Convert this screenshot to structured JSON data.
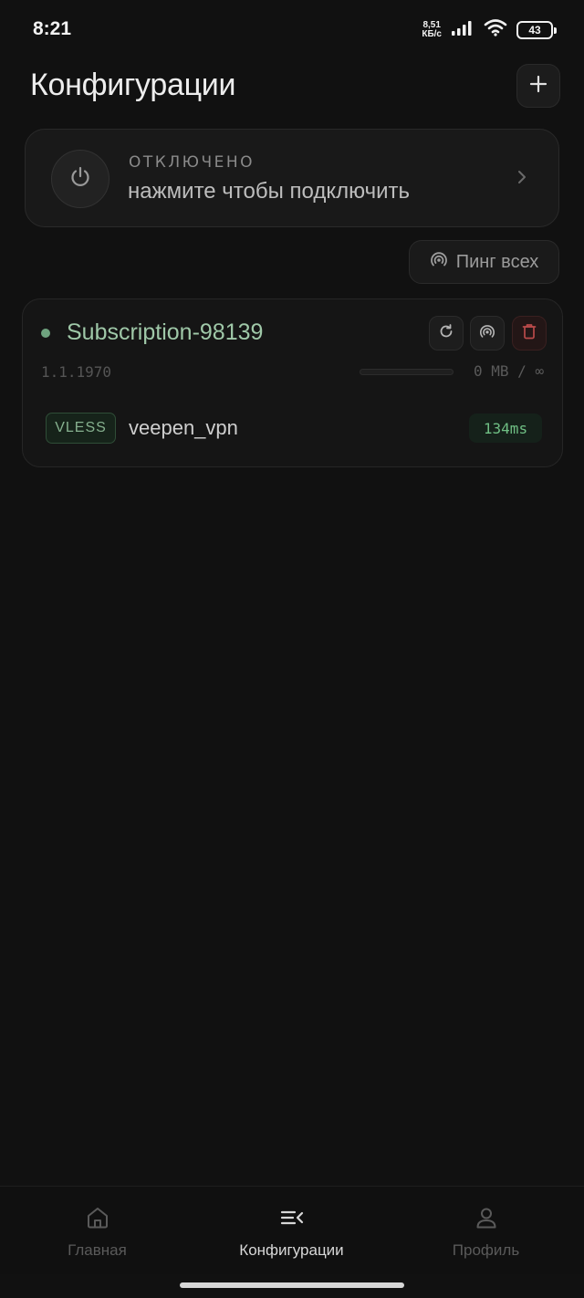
{
  "status_bar": {
    "time": "8:21",
    "net_speed_value": "8,51",
    "net_speed_unit": "КБ/с",
    "battery": "43",
    "icons": [
      "signal-icon",
      "wifi-icon",
      "battery-icon"
    ]
  },
  "header": {
    "title": "Конфигурации",
    "add_icon": "plus-icon"
  },
  "connect_card": {
    "status": "ОТКЛЮЧЕНО",
    "hint": "нажмите чтобы подключить",
    "icon": "power-icon"
  },
  "ping_all": {
    "label": "Пинг всех",
    "icon": "broadcast-icon"
  },
  "subscription": {
    "name": "Subscription-98139",
    "date": "1.1.1970",
    "traffic": "0 MB / ∞",
    "traffic_fill_fraction": 0,
    "actions": [
      "refresh-icon",
      "broadcast-icon",
      "trash-icon"
    ],
    "status_color": "#6fa37f",
    "servers": [
      {
        "protocol": "VLESS",
        "name": "veepen_vpn",
        "latency": "134ms"
      }
    ]
  },
  "bottom_nav": {
    "items": [
      {
        "label": "Главная",
        "icon": "home-icon",
        "active": false
      },
      {
        "label": "Конфигурации",
        "icon": "list-icon",
        "active": true
      },
      {
        "label": "Профиль",
        "icon": "user-icon",
        "active": false
      }
    ]
  },
  "colors": {
    "background": "#111111",
    "accent_green": "#6fbf84",
    "danger_red": "#b84a4a"
  }
}
